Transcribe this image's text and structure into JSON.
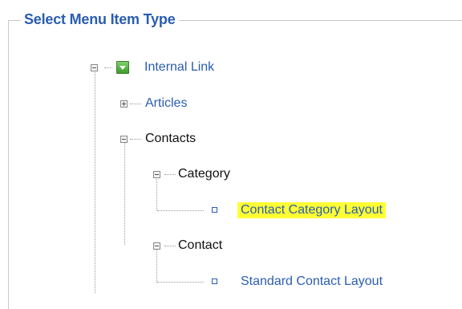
{
  "legend": "Select Menu Item Type",
  "tree": {
    "root": {
      "label": "Internal Link"
    },
    "articles": {
      "label": "Articles"
    },
    "contacts": {
      "label": "Contacts"
    },
    "category": {
      "label": "Category"
    },
    "contact_category_layout": {
      "label": "Contact Category Layout",
      "highlighted": true
    },
    "contact": {
      "label": "Contact"
    },
    "standard_contact_layout": {
      "label": "Standard Contact Layout"
    }
  },
  "colors": {
    "link": "#2a5db0",
    "highlight": "#ffff33",
    "legend": "#2a5db0"
  }
}
